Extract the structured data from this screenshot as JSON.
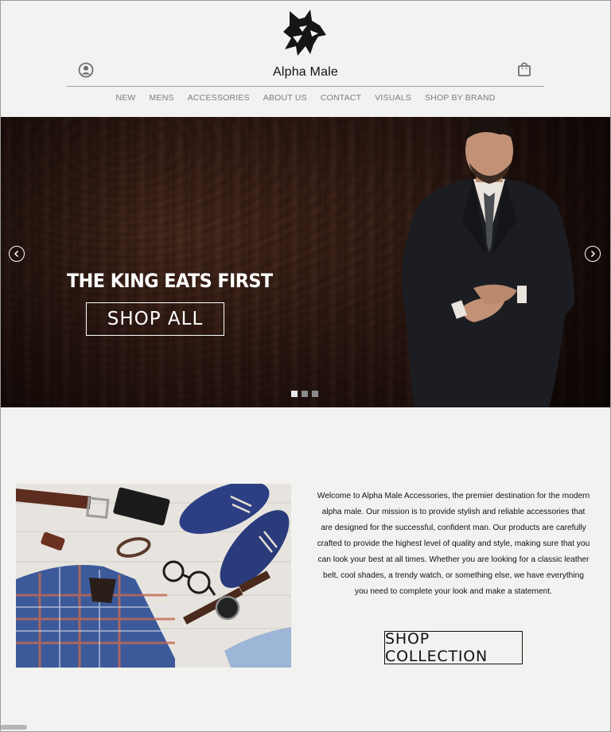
{
  "header": {
    "brand_name": "Alpha Male",
    "logo_icon": "wolf-head-logo",
    "account_icon": "user-circle-icon",
    "cart_icon": "shopping-bag-icon"
  },
  "nav": {
    "items": [
      "NEW",
      "MENS",
      "ACCESSORIES",
      "ABOUT US",
      "CONTACT",
      "VISUALS",
      "SHOP BY BRAND"
    ]
  },
  "hero": {
    "headline": "THE KING EATS FIRST",
    "cta_label": "SHOP ALL",
    "prev_icon": "chevron-left-icon",
    "next_icon": "chevron-right-icon",
    "slide_count": 3,
    "active_slide": 1
  },
  "intro": {
    "text": "Welcome to Alpha Male Accessories, the premier destination for the modern alpha male. Our mission is to provide stylish and reliable accessories that are designed for the successful, confident man. Our products are carefully crafted to provide the highest level of quality and style, making sure that you can look your best at all times. Whether you are looking for a classic leather belt, cool shades, a trendy watch, or something else, we have everything you need to complete your look and make a statement.",
    "cta_label": "SHOP COLLECTION"
  },
  "colors": {
    "background": "#f2f2f0",
    "nav_text": "#7c7c7c",
    "hero_wood": "#2c1610"
  }
}
